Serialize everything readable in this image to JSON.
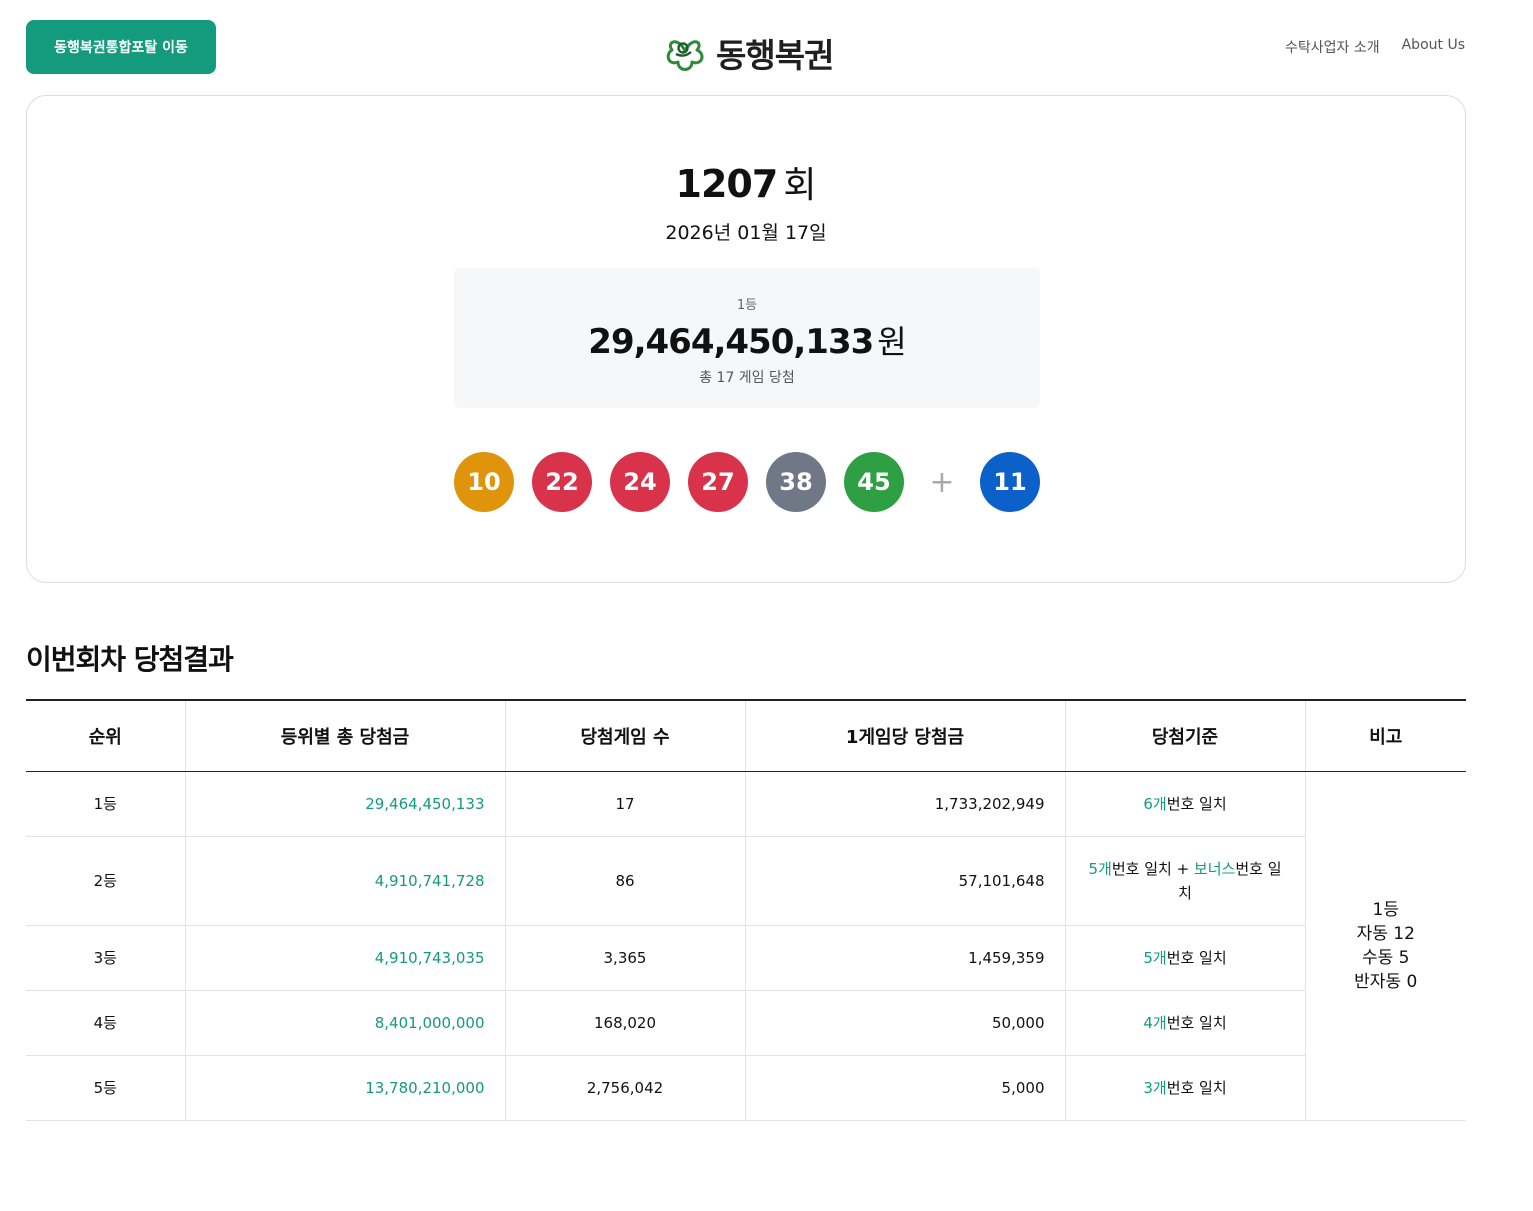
{
  "header": {
    "portal_button": "동행복권통합포탈 이동",
    "logo_text": "동행복권",
    "nav": [
      "수탁사업자 소개",
      "About Us"
    ]
  },
  "draw": {
    "round_number": "1207",
    "round_unit": "회",
    "date": "2026년 01월 17일",
    "first_prize": {
      "rank": "1등",
      "amount": "29,464,450,133",
      "currency": "원",
      "winners_text": "총 17 게임 당첨"
    },
    "numbers": [
      {
        "value": "10",
        "color": "#e0940c"
      },
      {
        "value": "22",
        "color": "#d8334a"
      },
      {
        "value": "24",
        "color": "#d8334a"
      },
      {
        "value": "27",
        "color": "#d8334a"
      },
      {
        "value": "38",
        "color": "#707787"
      },
      {
        "value": "45",
        "color": "#2ea043"
      }
    ],
    "plus_sign": "+",
    "bonus": {
      "value": "11",
      "color": "#0b61c9"
    }
  },
  "results": {
    "title": "이번회차 당첨결과",
    "headers": [
      "순위",
      "등위별 총 당첨금",
      "당첨게임 수",
      "1게임당 당첨금",
      "당첨기준",
      "비고"
    ],
    "rows": [
      {
        "rank": "1등",
        "total": "29,464,450,133",
        "count": "17",
        "per_game": "1,733,202,949",
        "crit_a": "6개",
        "crit_b": "번호 일치",
        "crit_c": "",
        "crit_d": ""
      },
      {
        "rank": "2등",
        "total": "4,910,741,728",
        "count": "86",
        "per_game": "57,101,648",
        "crit_a": "5개",
        "crit_b": "번호 일치 + ",
        "crit_c": "보너스",
        "crit_d": "번호 일치"
      },
      {
        "rank": "3등",
        "total": "4,910,743,035",
        "count": "3,365",
        "per_game": "1,459,359",
        "crit_a": "5개",
        "crit_b": "번호 일치",
        "crit_c": "",
        "crit_d": ""
      },
      {
        "rank": "4등",
        "total": "8,401,000,000",
        "count": "168,020",
        "per_game": "50,000",
        "crit_a": "4개",
        "crit_b": "번호 일치",
        "crit_c": "",
        "crit_d": ""
      },
      {
        "rank": "5등",
        "total": "13,780,210,000",
        "count": "2,756,042",
        "per_game": "5,000",
        "crit_a": "3개",
        "crit_b": "번호 일치",
        "crit_c": "",
        "crit_d": ""
      }
    ],
    "note_lines": [
      "1등",
      "자동 12",
      "수동 5",
      "반자동 0"
    ]
  }
}
